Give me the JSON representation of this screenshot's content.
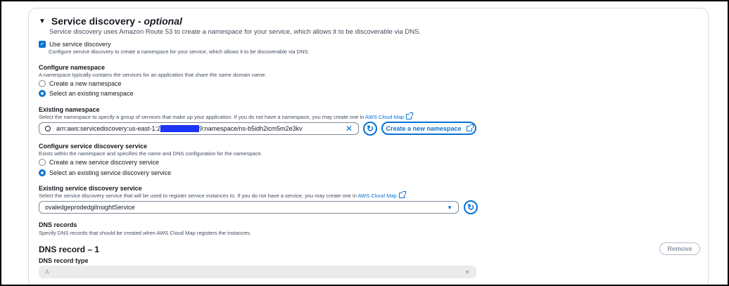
{
  "service_discovery": {
    "title": "Service discovery - ",
    "title_optional": "optional",
    "description": "Service discovery uses Amazon Route 53 to create a namespace for your service, which allows it to be discoverable via DNS.",
    "use_checkbox_label": "Use service discovery",
    "use_checkbox_desc": "Configure service discovery to create a namespace for your service, which allows it to be discoverable via DNS.",
    "use_checkbox_checked": true
  },
  "configure_namespace": {
    "label": "Configure namespace",
    "desc": "A namespace typically contains the services for an application that share the same domain name.",
    "options": [
      {
        "label": "Create a new namespace",
        "selected": false
      },
      {
        "label": "Select an existing namespace",
        "selected": true
      }
    ]
  },
  "existing_namespace": {
    "label": "Existing namespace",
    "desc": "Select the namespace to specify a group of services that make up your application. If you do not have a namespace, you may create one in ",
    "link": "AWS Cloud Map",
    "value_prefix": "arn:aws:servicediscovery:us-east-1:2",
    "value_suffix": "9:namespace/ns-b5idh2icm5m2e3kv",
    "clear_icon": "x-icon",
    "refresh_icon": "refresh-icon",
    "create_button": "Create a new namespace"
  },
  "configure_service": {
    "label": "Configure service discovery service",
    "desc": "Exists within the namespace and specifies the name and DNS configuration for the namespace.",
    "options": [
      {
        "label": "Create a new service discovery service",
        "selected": false
      },
      {
        "label": "Select an existing service discovery service",
        "selected": true
      }
    ]
  },
  "existing_service": {
    "label": "Existing service discovery service",
    "desc": "Select the service discovery service that will be used to register service instances to. If you do not have a service, you may create one in ",
    "link": "AWS Cloud Map",
    "value": "ovaledgeprodedgilnsightService"
  },
  "dns_records": {
    "label": "DNS records",
    "desc": "Specify DNS records that should be created when AWS Cloud Map registers the instances.",
    "record_title": "DNS record – 1",
    "remove_button": "Remove",
    "type_label": "DNS record type",
    "type_value": "A"
  },
  "colors": {
    "accent": "#0972d3",
    "text": "#16191f",
    "muted": "#414d5c"
  }
}
